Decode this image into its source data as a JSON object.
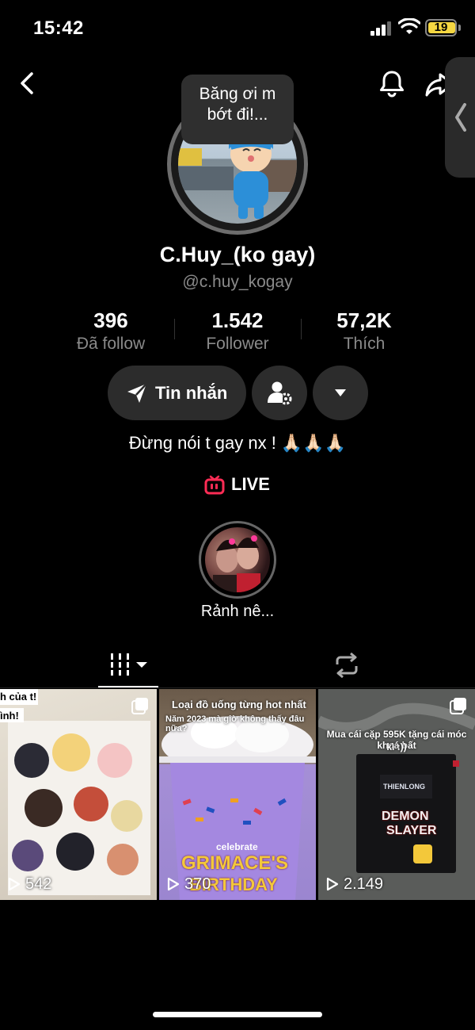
{
  "status_bar": {
    "time": "15:42",
    "battery": "19"
  },
  "header": {
    "back_icon": "chevron-left-icon",
    "bell_icon": "bell-icon",
    "share_icon": "share-icon",
    "side_handle_icon": "chevron-left-icon"
  },
  "profile": {
    "note": "Băng ơi m\nbớt đi!...",
    "display_name": "C.Huy_(ko gay)",
    "username": "@c.huy_kogay",
    "stats": [
      {
        "value": "396",
        "label": "Đã follow"
      },
      {
        "value": "1.542",
        "label": "Follower"
      },
      {
        "value": "57,2K",
        "label": "Thích"
      }
    ],
    "message_button": "Tin nhắn",
    "bio": "Đừng nói t gay nx ! 🙏🏻🙏🏻🙏🏻",
    "live_label": "LIVE",
    "highlight_label": "Rảnh nê..."
  },
  "tabs": [
    {
      "icon": "grid-icon",
      "active": true
    },
    {
      "icon": "repost-icon",
      "active": false
    }
  ],
  "videos": [
    {
      "views": "542",
      "caption_lines": [
        "h của t!",
        "ình!"
      ]
    },
    {
      "views": "370",
      "caption_lines": [
        "Loại đồ uống từng hot nhất",
        "Năm 2023 mà giờ không thấy đâu nữa?"
      ],
      "cup_text": [
        "celebrate",
        "GRIMACE'S",
        "BIRTHDAY"
      ]
    },
    {
      "views": "2.149",
      "caption_lines": [
        "Mua cái cặp 595K tặng cái móc khoá bất",
        "kì :))"
      ],
      "box_text": [
        "THIENLONG",
        "DEMON",
        "SLAYER"
      ]
    }
  ],
  "colors": {
    "background": "#000000",
    "button": "#2c2c2c",
    "live_accent": "#fe2c55",
    "battery": "#f5d742"
  }
}
